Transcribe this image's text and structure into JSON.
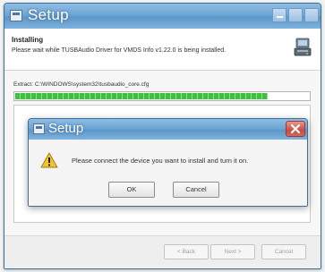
{
  "window": {
    "title": "Setup",
    "header": {
      "heading": "Installing",
      "description": "Please wait while TUSBAudio Driver for VMDS Info v1.22.0 is being installed."
    },
    "progress": {
      "label": "Extract: C:\\WINDOWS\\system32\\tusbaudio_core.cfg",
      "fraction": 0.86
    },
    "buttons": {
      "back": "< Back",
      "next": "Next >",
      "cancel": "Cancel"
    }
  },
  "dialog": {
    "title": "Setup",
    "message": "Please connect the device you want to install and turn it on.",
    "buttons": {
      "ok": "OK",
      "cancel": "Cancel"
    }
  },
  "colors": {
    "titlebar": "#6ea6d6",
    "progress": "#3bc13b",
    "close": "#cc4b3f"
  },
  "icons": {
    "app": "setup-window-icon",
    "installer": "installer-icon",
    "warning": "warning-icon",
    "close": "close-icon"
  }
}
